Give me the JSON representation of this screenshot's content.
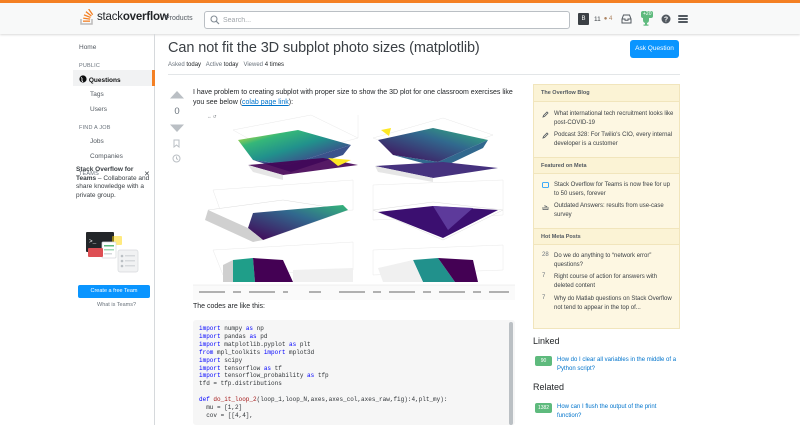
{
  "topbar": {
    "logo_light": "stack",
    "logo_bold": "overflow",
    "products": "Products",
    "search_placeholder": "Search...",
    "avatar_letter": "B",
    "reputation": "11",
    "bronze": "● 4",
    "achievements_count": "+20"
  },
  "leftnav": {
    "home": "Home",
    "public": "PUBLIC",
    "questions": "Questions",
    "tags": "Tags",
    "users": "Users",
    "find_a_job": "FIND A JOB",
    "jobs": "Jobs",
    "companies": "Companies",
    "teams": "TEAMS",
    "teams_close": "✕",
    "teams_title_bold_1": "Stack Overflow for",
    "teams_title_bold_2": "Teams",
    "teams_title_rest": " – Collaborate and share knowledge with a private group.",
    "teams_button": "Create a free Team",
    "teams_link": "What is Teams?"
  },
  "question": {
    "title": "Can not fit the 3D subplot photo sizes (matplotlib)",
    "ask_button": "Ask Question",
    "asked_label": "Asked",
    "asked_value": "today",
    "active_label": "Active",
    "active_value": "today",
    "viewed_label": "Viewed",
    "viewed_value": "4 times",
    "votes": "0",
    "body_text": "I have problem to creating subplot with proper size to show the 3D plot for one classroom exercises like you see below (",
    "body_link": "colab page link",
    "body_end": "):",
    "codes_label": "The codes are like this:"
  },
  "code_lines": [
    [
      [
        "kw",
        "import"
      ],
      [
        "",
        "numpy "
      ],
      [
        "kw",
        "as"
      ],
      [
        "",
        "np"
      ]
    ],
    [
      [
        "kw",
        "import"
      ],
      [
        "",
        "pandas "
      ],
      [
        "kw",
        "as"
      ],
      [
        "",
        "pd"
      ]
    ],
    [
      [
        "kw",
        "import"
      ],
      [
        "",
        "matplotlib.pyplot "
      ],
      [
        "kw",
        "as"
      ],
      [
        "",
        "plt"
      ]
    ],
    [
      [
        "kw",
        "from"
      ],
      [
        "",
        "mpl_toolkits "
      ],
      [
        "kw",
        "import"
      ],
      [
        "",
        "mplot3d"
      ]
    ],
    [
      [
        "kw",
        "import"
      ],
      [
        "",
        "scipy"
      ]
    ],
    [
      [
        "kw",
        "import"
      ],
      [
        "",
        "tensorflow "
      ],
      [
        "kw",
        "as"
      ],
      [
        "",
        "tf"
      ]
    ],
    [
      [
        "kw",
        "import"
      ],
      [
        "",
        "tensorflow_probability "
      ],
      [
        "kw",
        "as"
      ],
      [
        "",
        "tfp"
      ]
    ],
    [
      [
        "",
        "tfd = tfp.distributions"
      ]
    ],
    [
      [
        "",
        ""
      ]
    ],
    [
      [
        "kw",
        "def "
      ],
      [
        "fn",
        "do_it_loop_2"
      ],
      [
        "",
        "(loop_1,loop_N,axes,axes_col,axes_raw,fig):4,plt_my):"
      ]
    ],
    [
      [
        "",
        "  mu = [1,2]"
      ]
    ],
    [
      [
        "",
        "  cov = [[4,4],"
      ]
    ]
  ],
  "sidebar": {
    "blog_head": "The Overflow Blog",
    "blog_items": [
      "What international tech recruitment looks like post-COVID-19",
      "Podcast 328: For Twilio's CIO, every internal developer is a customer"
    ],
    "featured_head": "Featured on Meta",
    "featured_items": [
      "Stack Overflow for Teams is now free for up to 50 users, forever",
      "Outdated Answers: results from use-case survey"
    ],
    "hot_head": "Hot Meta Posts",
    "hot_items": [
      {
        "num": "28",
        "text": "Do we do anything to “network error” questions?"
      },
      {
        "num": "7",
        "text": "Right course of action for answers with deleted content"
      },
      {
        "num": "7",
        "text": "Why do Matlab questions on Stack Overflow not tend to appear in the top of..."
      }
    ],
    "linked_head": "Linked",
    "linked_items": [
      {
        "score": "90",
        "text": "How do I clear all variables in the middle of a Python script?"
      }
    ],
    "related_head": "Related",
    "related_items": [
      {
        "score": "1382",
        "text": "How can I flush the output of the print function?"
      }
    ]
  },
  "colors": {
    "accent": "#f48024",
    "link": "#0074cc",
    "button": "#0a95ff",
    "score_green": "#5eba7d",
    "blog_bg": "#fdf7e2"
  }
}
